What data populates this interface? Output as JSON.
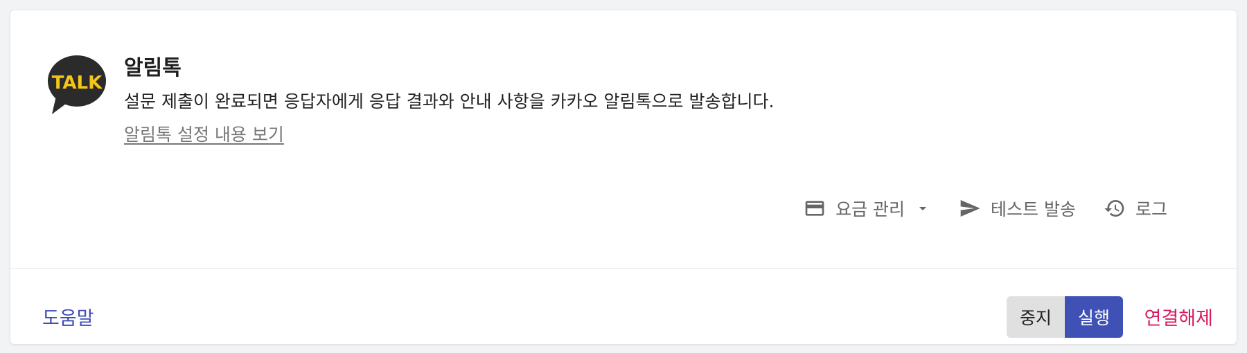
{
  "integration": {
    "logo_text": "TALK",
    "title": "알림톡",
    "description": "설문 제출이 완료되면 응답자에게 응답 결과와 안내 사항을 카카오 알림톡으로 발송합니다.",
    "settings_link": "알림톡 설정 내용 보기"
  },
  "actions": {
    "billing_label": "요금 관리",
    "test_send_label": "테스트 발송",
    "log_label": "로그"
  },
  "footer": {
    "help_label": "도움말",
    "stop_label": "중지",
    "run_label": "실행",
    "disconnect_label": "연결해제"
  },
  "colors": {
    "brand_yellow": "#f5c518",
    "bubble_dark": "#2b2b2b",
    "primary": "#3f51b5",
    "danger": "#d81b60",
    "link_blue": "#3e4db3"
  },
  "icons": {
    "logo": "kakaotalk-logo-icon",
    "billing": "credit-card-icon",
    "dropdown": "caret-down-icon",
    "test_send": "send-icon",
    "log": "history-icon"
  }
}
